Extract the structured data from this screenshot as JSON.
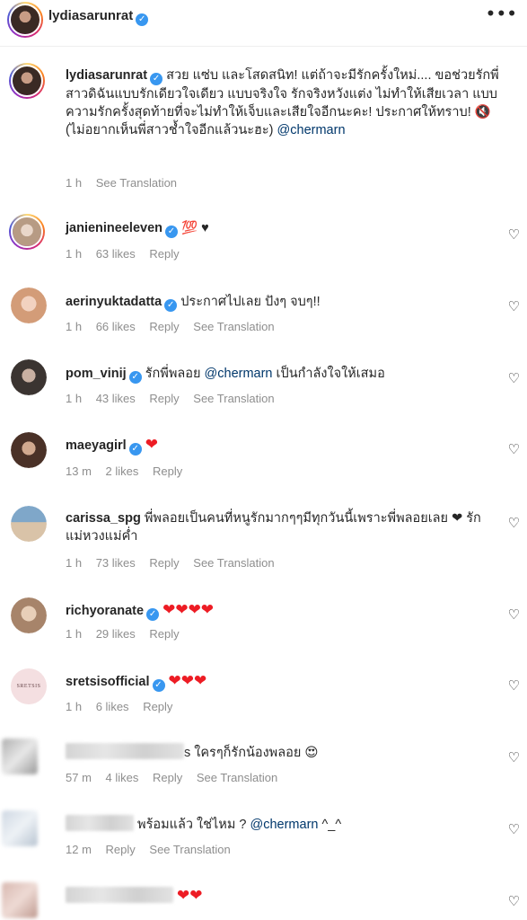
{
  "header": {
    "username": "lydiasarunrat",
    "more_icon": "more-horizontal-icon"
  },
  "caption": {
    "username": "lydiasarunrat",
    "text": "สวย แซ่บ และโสดสนิท! แต่ถ้าจะมีรักครั้งใหม่.... ขอช่วยรักพี่สาวดิฉันแบบรักเดียวใจเดียว แบบจริงใจ รักจริงหวังแต่ง ไม่ทำให้เสียเวลา แบบความรักครั้งสุดท้ายที่จะไม่ทำให้เจ็บและเสียใจอีกนะคะ! ประกาศให้ทราบ! 🔇 (ไม่อยากเห็นพี่สาวช้ำใจอีกแล้วนะฮะ)",
    "mention": "@chermarn",
    "time": "1 h",
    "see_translation": "See Translation"
  },
  "comments": [
    {
      "username": "janienineeleven",
      "text": "💯 ♥",
      "time": "1 h",
      "likes": "63 likes",
      "reply": "Reply",
      "translation": ""
    },
    {
      "username": "aerinyuktadatta",
      "text": "ประกาศไปเลย ปังๆ จบๆ!!",
      "time": "1 h",
      "likes": "66 likes",
      "reply": "Reply",
      "translation": "See Translation"
    },
    {
      "username": "pom_vinij",
      "text_before": "รักพี่พลอย",
      "mention": "@chermarn",
      "text_after": "เป็นกำลังใจให้เสมอ",
      "time": "1 h",
      "likes": "43 likes",
      "reply": "Reply",
      "translation": "See Translation"
    },
    {
      "username": "maeyagirl",
      "text": "❤",
      "time": "13 m",
      "likes": "2 likes",
      "reply": "Reply",
      "translation": ""
    },
    {
      "username": "carissa_spg",
      "text": "พี่พลอยเป็นคนที่หนูรักมากๆๆมีทุกวันนี้เพราะพี่พลอยเลย ❤ รักแม่หวงแม่ค่ำ",
      "time": "1 h",
      "likes": "73 likes",
      "reply": "Reply",
      "translation": "See Translation"
    },
    {
      "username": "richyoranate",
      "text": "❤❤❤❤",
      "time": "1 h",
      "likes": "29 likes",
      "reply": "Reply",
      "translation": ""
    },
    {
      "username": "sretsisofficial",
      "text": "❤❤❤",
      "avatar_text": "SRETSIS",
      "time": "1 h",
      "likes": "6 likes",
      "reply": "Reply",
      "translation": ""
    },
    {
      "username": "",
      "text": "s ใครๆก็รักน้องพลอย 😍",
      "time": "57 m",
      "likes": "4 likes",
      "reply": "Reply",
      "translation": "See Translation"
    },
    {
      "username": "",
      "text_before": "พร้อมแล้ว ใช่ไหม ?",
      "mention": "@chermarn",
      "text_after": "^_^",
      "time": "12 m",
      "likes": "",
      "reply": "Reply",
      "translation": "See Translation"
    },
    {
      "username": "",
      "text": "❤❤",
      "time": "",
      "likes": "",
      "reply": "",
      "translation": ""
    }
  ],
  "icons": {
    "like": "heart-outline-icon",
    "verified": "verified-badge-icon"
  }
}
